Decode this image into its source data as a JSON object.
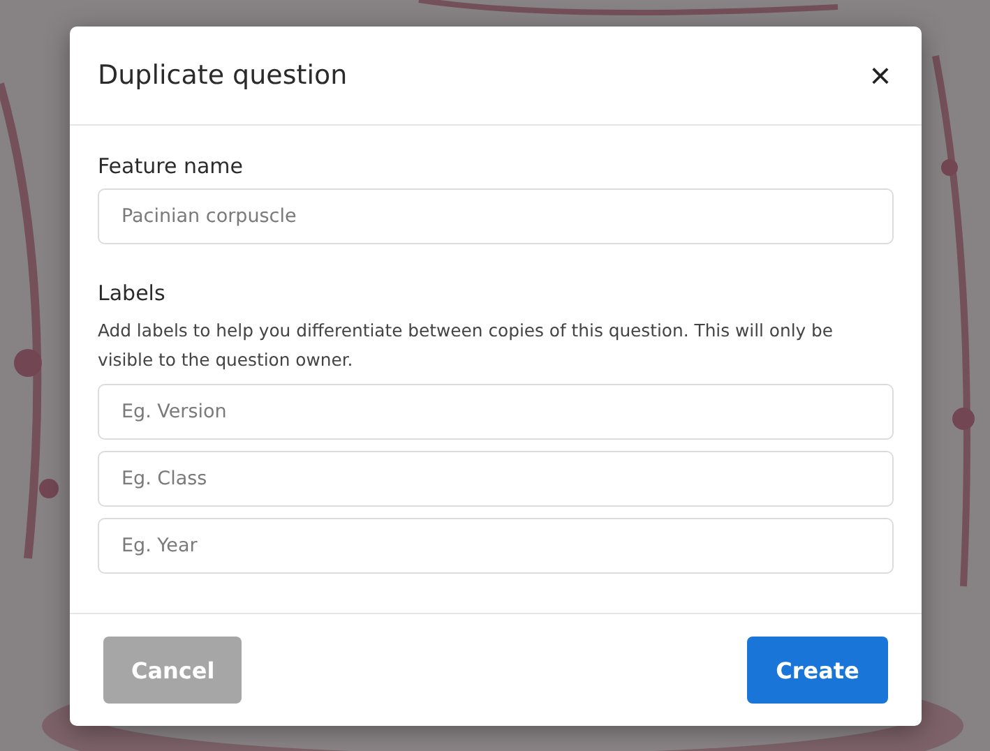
{
  "dialog": {
    "title": "Duplicate question",
    "close": "×"
  },
  "feature_name": {
    "label": "Feature name",
    "placeholder": "Pacinian corpuscle"
  },
  "labels": {
    "label": "Labels",
    "help": "Add labels to help you differentiate between copies of this question. This will only be visible to the question owner.",
    "fields": [
      {
        "placeholder": "Eg. Version"
      },
      {
        "placeholder": "Eg. Class"
      },
      {
        "placeholder": "Eg. Year"
      }
    ]
  },
  "buttons": [
    {
      "label": "Cancel",
      "kind": "secondary"
    },
    {
      "label": "Create",
      "kind": "primary"
    }
  ]
}
